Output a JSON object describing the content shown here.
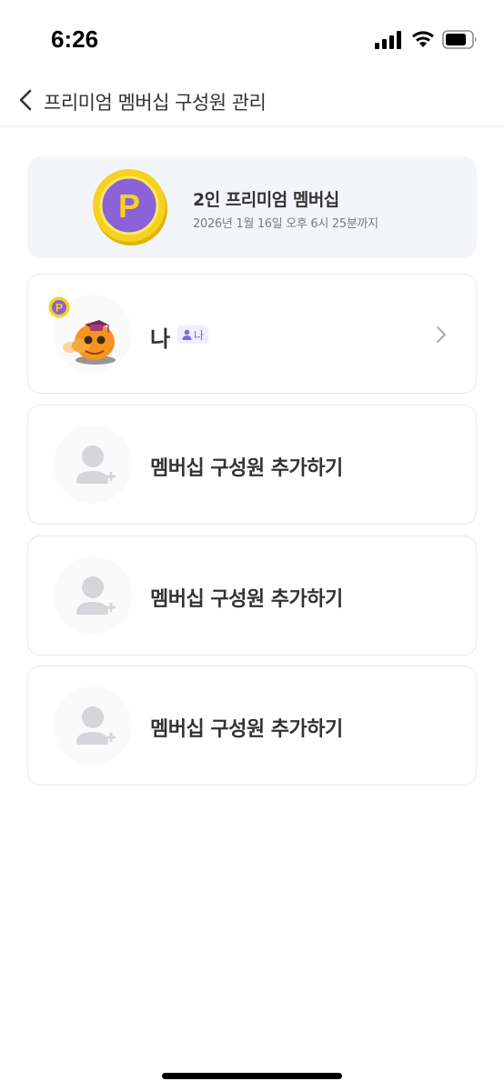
{
  "status_bar": {
    "time": "6:26"
  },
  "header": {
    "title": "프리미엄 멤버십 구성원 관리"
  },
  "plan": {
    "title": "2인 프리미엄 멤버십",
    "expiry": "2026년 1월 16일 오후 6시 25분까지",
    "coin_letter": "P"
  },
  "members": [
    {
      "name": "나",
      "tag": "나"
    }
  ],
  "add_slots": [
    {
      "label": "멤버십 구성원 추가하기"
    },
    {
      "label": "멤버십 구성원 추가하기"
    },
    {
      "label": "멤버십 구성원 추가하기"
    }
  ],
  "colors": {
    "accent_purple": "#7b68e0",
    "coin_gold": "#f6d21c",
    "avatar_orange": "#f7931e"
  }
}
